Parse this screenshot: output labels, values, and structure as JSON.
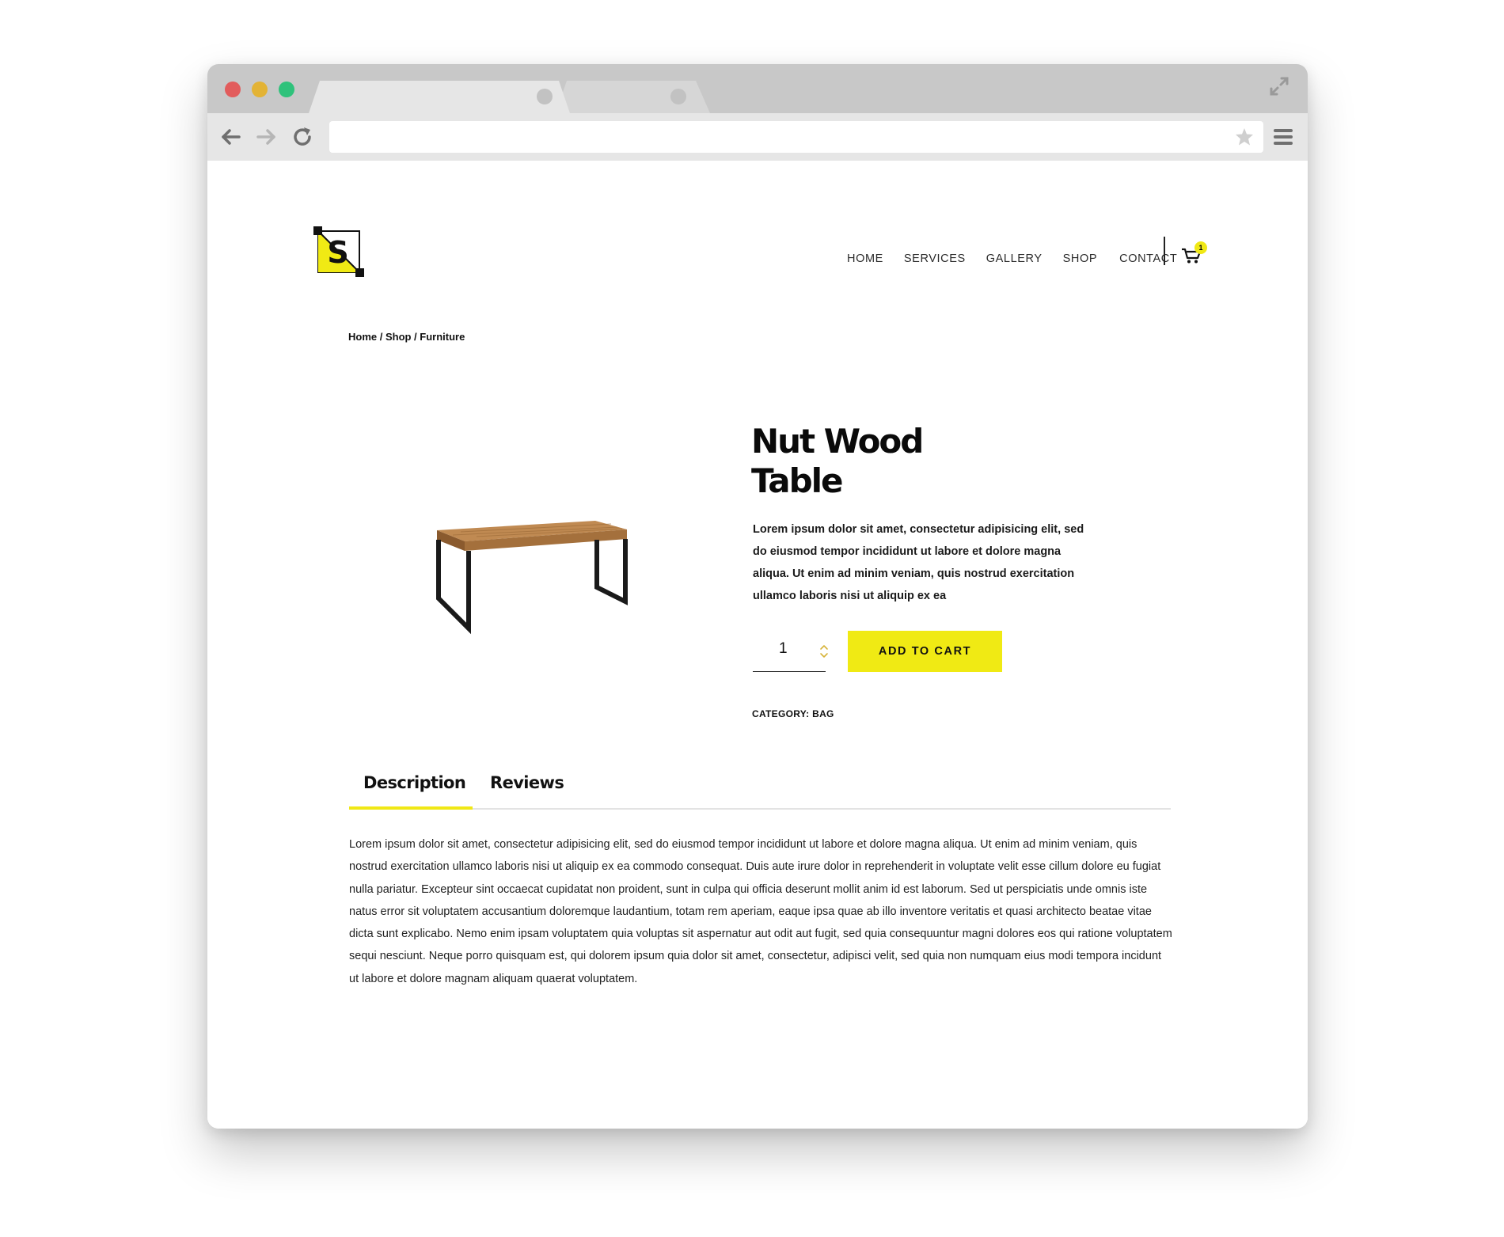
{
  "browser": {
    "icons": {
      "back": "arrow-left-icon",
      "forward": "arrow-right-icon",
      "reload": "reload-icon",
      "bookmark": "star-icon",
      "menu": "hamburger-menu-icon",
      "expand": "expand-icon"
    },
    "url": ""
  },
  "site": {
    "logo_letter": "S",
    "nav": [
      "HOME",
      "SERVICES",
      "GALLERY",
      "SHOP",
      "CONTACT"
    ],
    "cart_count": "1"
  },
  "breadcrumb": "Home / Shop / Furniture",
  "product": {
    "title_line1": "Nut Wood",
    "title_line2": "Table",
    "short_description": "Lorem ipsum dolor sit amet, consectetur adipisicing elit, sed do eiusmod tempor incididunt ut labore et dolore magna aliqua. Ut enim ad minim veniam, quis nostrud exercitation ullamco laboris nisi ut aliquip ex ea",
    "quantity": "1",
    "add_to_cart_label": "ADD TO CART",
    "category_text": "CATEGORY: BAG"
  },
  "tabs": {
    "description_label": "Description",
    "reviews_label": "Reviews",
    "active": "Description"
  },
  "description_body": "Lorem ipsum dolor sit amet, consectetur adipisicing elit, sed do eiusmod tempor incididunt ut labore et dolore magna aliqua. Ut enim ad minim veniam, quis nostrud exercitation ullamco laboris nisi ut aliquip ex ea commodo consequat. Duis aute irure dolor in reprehenderit in voluptate velit esse cillum dolore eu fugiat nulla pariatur. Excepteur sint occaecat cupidatat non proident, sunt in culpa qui officia deserunt mollit anim id est laborum. Sed ut perspiciatis unde omnis iste natus error sit voluptatem accusantium doloremque laudantium, totam rem aperiam, eaque ipsa quae ab illo inventore veritatis et quasi architecto beatae vitae dicta sunt explicabo. Nemo enim ipsam voluptatem quia voluptas sit aspernatur aut odit aut fugit, sed quia consequuntur magni dolores eos qui ratione voluptatem sequi nesciunt. Neque porro quisquam est, qui dolorem ipsum quia dolor sit amet, consectetur, adipisci velit, sed quia non numquam eius modi tempora incidunt ut labore et dolore magnam aliquam quaerat voluptatem.",
  "colors": {
    "accent": "#f0ea14",
    "text": "#111111",
    "chrome": "#c8c8c8",
    "toolbar": "#e6e6e6"
  }
}
